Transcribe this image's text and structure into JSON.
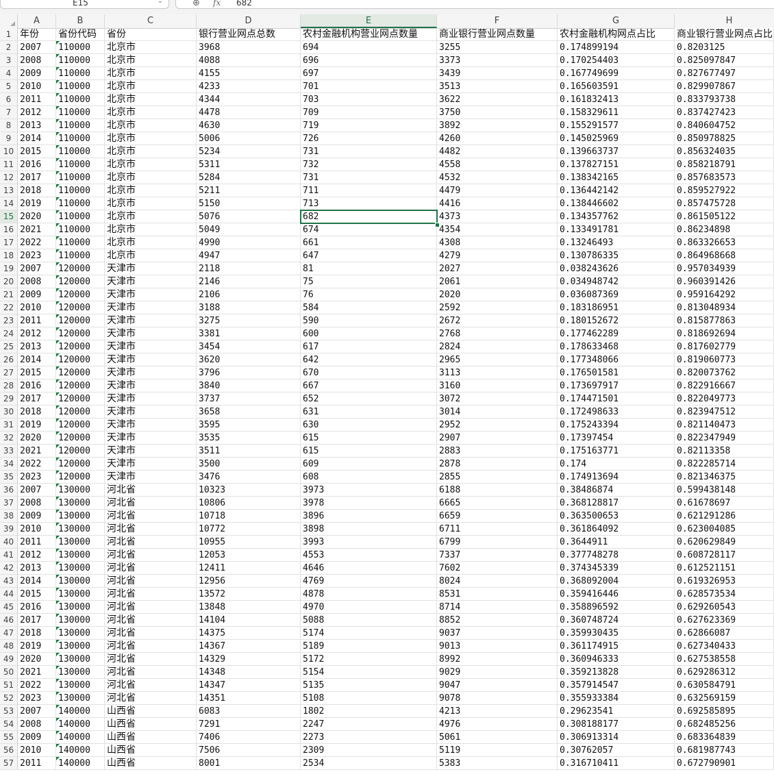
{
  "formula_bar": {
    "name_box": "E15",
    "fx": "fx",
    "value": "682"
  },
  "columns": [
    "A",
    "B",
    "C",
    "D",
    "E",
    "F",
    "G",
    "H"
  ],
  "active_column": "E",
  "selected_row": 15,
  "header_row": [
    "年份",
    "省份代码",
    "省份",
    "银行营业网点总数",
    "农村金融机构营业网点数量",
    "商业银行营业网点数量",
    "农村金融机构网点占比",
    "商业银行营业网点占比"
  ],
  "rows": [
    [
      "2007",
      "110000",
      "北京市",
      "3968",
      "694",
      "3255",
      "0.174899194",
      "0.8203125"
    ],
    [
      "2008",
      "110000",
      "北京市",
      "4088",
      "696",
      "3373",
      "0.170254403",
      "0.825097847"
    ],
    [
      "2009",
      "110000",
      "北京市",
      "4155",
      "697",
      "3439",
      "0.167749699",
      "0.827677497"
    ],
    [
      "2010",
      "110000",
      "北京市",
      "4233",
      "701",
      "3513",
      "0.165603591",
      "0.829907867"
    ],
    [
      "2011",
      "110000",
      "北京市",
      "4344",
      "703",
      "3622",
      "0.161832413",
      "0.833793738"
    ],
    [
      "2012",
      "110000",
      "北京市",
      "4478",
      "709",
      "3750",
      "0.158329611",
      "0.837427423"
    ],
    [
      "2013",
      "110000",
      "北京市",
      "4630",
      "719",
      "3892",
      "0.155291577",
      "0.840604752"
    ],
    [
      "2014",
      "110000",
      "北京市",
      "5006",
      "726",
      "4260",
      "0.145025969",
      "0.850978825"
    ],
    [
      "2015",
      "110000",
      "北京市",
      "5234",
      "731",
      "4482",
      "0.139663737",
      "0.856324035"
    ],
    [
      "2016",
      "110000",
      "北京市",
      "5311",
      "732",
      "4558",
      "0.137827151",
      "0.858218791"
    ],
    [
      "2017",
      "110000",
      "北京市",
      "5284",
      "731",
      "4532",
      "0.138342165",
      "0.857683573"
    ],
    [
      "2018",
      "110000",
      "北京市",
      "5211",
      "711",
      "4479",
      "0.136442142",
      "0.859527922"
    ],
    [
      "2019",
      "110000",
      "北京市",
      "5150",
      "713",
      "4416",
      "0.138446602",
      "0.857475728"
    ],
    [
      "2020",
      "110000",
      "北京市",
      "5076",
      "682",
      "4373",
      "0.134357762",
      "0.861505122"
    ],
    [
      "2021",
      "110000",
      "北京市",
      "5049",
      "674",
      "4354",
      "0.133491781",
      "0.86234898"
    ],
    [
      "2022",
      "110000",
      "北京市",
      "4990",
      "661",
      "4308",
      "0.13246493",
      "0.863326653"
    ],
    [
      "2023",
      "110000",
      "北京市",
      "4947",
      "647",
      "4279",
      "0.130786335",
      "0.864968668"
    ],
    [
      "2007",
      "120000",
      "天津市",
      "2118",
      "81",
      "2027",
      "0.038243626",
      "0.957034939"
    ],
    [
      "2008",
      "120000",
      "天津市",
      "2146",
      "75",
      "2061",
      "0.034948742",
      "0.960391426"
    ],
    [
      "2009",
      "120000",
      "天津市",
      "2106",
      "76",
      "2020",
      "0.036087369",
      "0.959164292"
    ],
    [
      "2010",
      "120000",
      "天津市",
      "3188",
      "584",
      "2592",
      "0.183186951",
      "0.813048934"
    ],
    [
      "2011",
      "120000",
      "天津市",
      "3275",
      "590",
      "2672",
      "0.180152672",
      "0.815877863"
    ],
    [
      "2012",
      "120000",
      "天津市",
      "3381",
      "600",
      "2768",
      "0.177462289",
      "0.818692694"
    ],
    [
      "2013",
      "120000",
      "天津市",
      "3454",
      "617",
      "2824",
      "0.178633468",
      "0.817602779"
    ],
    [
      "2014",
      "120000",
      "天津市",
      "3620",
      "642",
      "2965",
      "0.177348066",
      "0.819060773"
    ],
    [
      "2015",
      "120000",
      "天津市",
      "3796",
      "670",
      "3113",
      "0.176501581",
      "0.820073762"
    ],
    [
      "2016",
      "120000",
      "天津市",
      "3840",
      "667",
      "3160",
      "0.173697917",
      "0.822916667"
    ],
    [
      "2017",
      "120000",
      "天津市",
      "3737",
      "652",
      "3072",
      "0.174471501",
      "0.822049773"
    ],
    [
      "2018",
      "120000",
      "天津市",
      "3658",
      "631",
      "3014",
      "0.172498633",
      "0.823947512"
    ],
    [
      "2019",
      "120000",
      "天津市",
      "3595",
      "630",
      "2952",
      "0.175243394",
      "0.821140473"
    ],
    [
      "2020",
      "120000",
      "天津市",
      "3535",
      "615",
      "2907",
      "0.17397454",
      "0.822347949"
    ],
    [
      "2021",
      "120000",
      "天津市",
      "3511",
      "615",
      "2883",
      "0.175163771",
      "0.82113358"
    ],
    [
      "2022",
      "120000",
      "天津市",
      "3500",
      "609",
      "2878",
      "0.174",
      "0.822285714"
    ],
    [
      "2023",
      "120000",
      "天津市",
      "3476",
      "608",
      "2855",
      "0.174913694",
      "0.821346375"
    ],
    [
      "2007",
      "130000",
      "河北省",
      "10323",
      "3973",
      "6188",
      "0.38486874",
      "0.599438148"
    ],
    [
      "2008",
      "130000",
      "河北省",
      "10806",
      "3978",
      "6665",
      "0.368128817",
      "0.61678697"
    ],
    [
      "2009",
      "130000",
      "河北省",
      "10718",
      "3896",
      "6659",
      "0.363500653",
      "0.621291286"
    ],
    [
      "2010",
      "130000",
      "河北省",
      "10772",
      "3898",
      "6711",
      "0.361864092",
      "0.623004085"
    ],
    [
      "2011",
      "130000",
      "河北省",
      "10955",
      "3993",
      "6799",
      "0.3644911",
      "0.620629849"
    ],
    [
      "2012",
      "130000",
      "河北省",
      "12053",
      "4553",
      "7337",
      "0.377748278",
      "0.608728117"
    ],
    [
      "2013",
      "130000",
      "河北省",
      "12411",
      "4646",
      "7602",
      "0.374345339",
      "0.612521151"
    ],
    [
      "2014",
      "130000",
      "河北省",
      "12956",
      "4769",
      "8024",
      "0.368092004",
      "0.619326953"
    ],
    [
      "2015",
      "130000",
      "河北省",
      "13572",
      "4878",
      "8531",
      "0.359416446",
      "0.628573534"
    ],
    [
      "2016",
      "130000",
      "河北省",
      "13848",
      "4970",
      "8714",
      "0.358896592",
      "0.629260543"
    ],
    [
      "2017",
      "130000",
      "河北省",
      "14104",
      "5088",
      "8852",
      "0.360748724",
      "0.627623369"
    ],
    [
      "2018",
      "130000",
      "河北省",
      "14375",
      "5174",
      "9037",
      "0.359930435",
      "0.62866087"
    ],
    [
      "2019",
      "130000",
      "河北省",
      "14367",
      "5189",
      "9013",
      "0.361174915",
      "0.627340433"
    ],
    [
      "2020",
      "130000",
      "河北省",
      "14329",
      "5172",
      "8992",
      "0.360946333",
      "0.627538558"
    ],
    [
      "2021",
      "130000",
      "河北省",
      "14348",
      "5154",
      "9029",
      "0.359213828",
      "0.629286312"
    ],
    [
      "2022",
      "130000",
      "河北省",
      "14347",
      "5135",
      "9047",
      "0.357914547",
      "0.630584791"
    ],
    [
      "2023",
      "130000",
      "河北省",
      "14351",
      "5108",
      "9078",
      "0.355933384",
      "0.632569159"
    ],
    [
      "2007",
      "140000",
      "山西省",
      "6083",
      "1802",
      "4213",
      "0.29623541",
      "0.692585895"
    ],
    [
      "2008",
      "140000",
      "山西省",
      "7291",
      "2247",
      "4976",
      "0.308188177",
      "0.682485256"
    ],
    [
      "2009",
      "140000",
      "山西省",
      "7406",
      "2273",
      "5061",
      "0.306913314",
      "0.683364839"
    ],
    [
      "2010",
      "140000",
      "山西省",
      "7506",
      "2309",
      "5119",
      "0.30762057",
      "0.681987743"
    ],
    [
      "2011",
      "140000",
      "山西省",
      "8001",
      "2534",
      "5383",
      "0.316710411",
      "0.672790901"
    ]
  ]
}
